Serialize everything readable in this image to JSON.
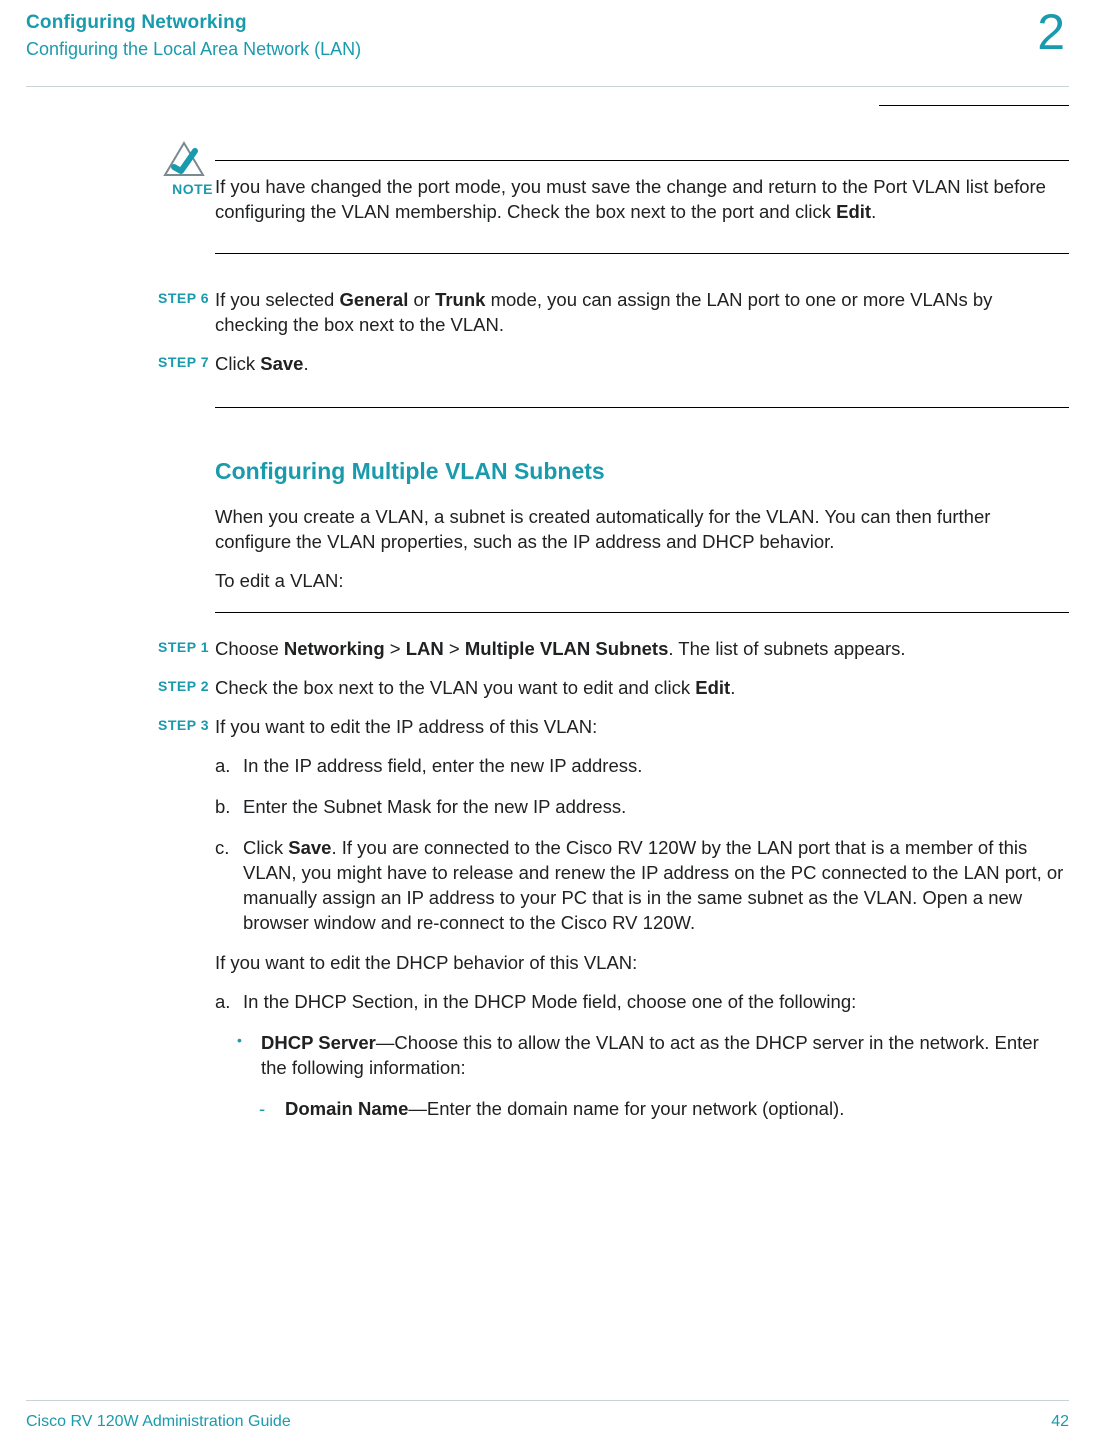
{
  "header": {
    "title": "Configuring Networking",
    "subtitle": "Configuring the Local Area Network (LAN)",
    "chapter": "2"
  },
  "note": {
    "label": "NOTE",
    "text_before": "If you have changed the port mode, you must save the change and return to the Port VLAN list before configuring the VLAN membership. Check the box next to the port and click ",
    "bold1": "Edit",
    "text_after": "."
  },
  "step6": {
    "label": "STEP  6",
    "p1_a": "If you selected ",
    "p1_b1": "General",
    "p1_b": " or ",
    "p1_b2": "Trunk",
    "p1_c": " mode, you can assign the LAN port to one or more VLANs by checking the box next to the VLAN."
  },
  "step7": {
    "label": "STEP  7",
    "p1_a": "Click ",
    "p1_b1": "Save",
    "p1_b": "."
  },
  "section": {
    "heading": "Configuring Multiple VLAN Subnets",
    "intro": "When you create a VLAN, a subnet is created automatically for the VLAN. You can then further configure the VLAN properties, such as the IP address and DHCP behavior.",
    "lead": "To edit a VLAN:"
  },
  "step1": {
    "label": "STEP 1",
    "a": "Choose ",
    "b1": "Networking",
    "b": " > ",
    "b2": "LAN",
    "c": " > ",
    "b3": "Multiple VLAN Subnets",
    "d": ". The list of subnets appears."
  },
  "step2": {
    "label": "STEP  2",
    "a": "Check the box next to the VLAN you want to edit and click ",
    "b1": "Edit",
    "b": "."
  },
  "step3": {
    "label": "STEP  3",
    "lead": "If you want to edit the IP address of this VLAN:",
    "a_lbl": "a.",
    "a_txt": "In the IP address field, enter the new IP address.",
    "b_lbl": "b.",
    "b_txt": "Enter the Subnet Mask for the new IP address.",
    "c_lbl": "c.",
    "c_a": "Click ",
    "c_b1": "Save",
    "c_b": ". If you are connected to the Cisco RV 120W by the LAN port that is a member of this VLAN, you might have to release and renew the IP address on the PC connected to the LAN port, or manually assign an IP address to your PC that is in the same subnet as the VLAN. Open a new browser window and re-connect to the Cisco RV 120W.",
    "dhcp_lead": "If you want to edit the DHCP behavior of this VLAN:",
    "d_lbl": "a.",
    "d_txt": "In the DHCP Section, in the DHCP Mode field, choose one of the following:",
    "bullet1_b1": "DHCP Server",
    "bullet1_txt": "—Choose this to allow the VLAN to act as the DHCP server in the network. Enter the following information:",
    "dash1_b1": "Domain Name",
    "dash1_txt": "—Enter the domain name for your network (optional)."
  },
  "footer": {
    "left": "Cisco RV 120W Administration Guide",
    "page": "42"
  },
  "colors": {
    "teal": "#1a9aad"
  }
}
